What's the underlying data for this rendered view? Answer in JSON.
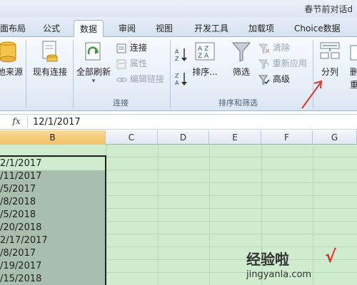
{
  "window": {
    "title": "春节前对话d"
  },
  "tabs": [
    {
      "label": "面布局",
      "active": false
    },
    {
      "label": "公式",
      "active": false
    },
    {
      "label": "数据",
      "active": true
    },
    {
      "label": "审阅",
      "active": false
    },
    {
      "label": "视图",
      "active": false
    },
    {
      "label": "开发工具",
      "active": false
    },
    {
      "label": "加载项",
      "active": false
    },
    {
      "label": "Choice数据",
      "active": false
    }
  ],
  "ribbon": {
    "get_external": {
      "label": "他来源",
      "icon": "database-icon"
    },
    "existing_connections": {
      "label": "现有连接",
      "icon": "document-icon"
    },
    "refresh_all": {
      "label": "全部刷新",
      "icon": "refresh-icon"
    },
    "connections": {
      "label": "连接",
      "icon": "connection-icon"
    },
    "properties": {
      "label": "属性",
      "icon": "properties-icon",
      "disabled": true
    },
    "edit_links": {
      "label": "编辑链接",
      "icon": "link-icon",
      "disabled": true
    },
    "connections_group_label": "连接",
    "sort_az_icon": "sort-ascending-icon",
    "sort_za_icon": "sort-descending-icon",
    "sort": {
      "label": "排序...",
      "icon": "sort-dialog-icon"
    },
    "filter": {
      "label": "筛选",
      "icon": "funnel-icon"
    },
    "clear": {
      "label": "清除",
      "icon": "clear-filter-icon",
      "disabled": true
    },
    "reapply": {
      "label": "重新应用",
      "icon": "reapply-icon",
      "disabled": true
    },
    "advanced": {
      "label": "高级",
      "icon": "advanced-filter-icon"
    },
    "sort_filter_group_label": "排序和筛选",
    "text_to_columns": {
      "label": "分列",
      "icon": "text-to-columns-icon"
    },
    "partial_next": {
      "label": "删\n重",
      "icon": "remove-duplicates-icon"
    }
  },
  "formula_bar": {
    "fx_label": "fx",
    "value": "12/1/2017"
  },
  "columns": [
    "B",
    "C",
    "D",
    "E",
    "F",
    "G"
  ],
  "selected_column": "B",
  "cells": [
    "2/1/2017",
    "/11/2017",
    "/5/2017",
    "/8/2018",
    "/5/2018",
    "/20/2018",
    "2/17/2017",
    "/8/2017",
    "/19/2017",
    "/15/2018"
  ],
  "watermark": {
    "brand": "经验啦",
    "check": "√",
    "url": "jingyanla.com"
  },
  "colors": {
    "accent": "#e0332a",
    "cell_bg": "#cfeccf",
    "selected_cells_bg": "#a9bfae",
    "header_selected": "#f2c063"
  }
}
